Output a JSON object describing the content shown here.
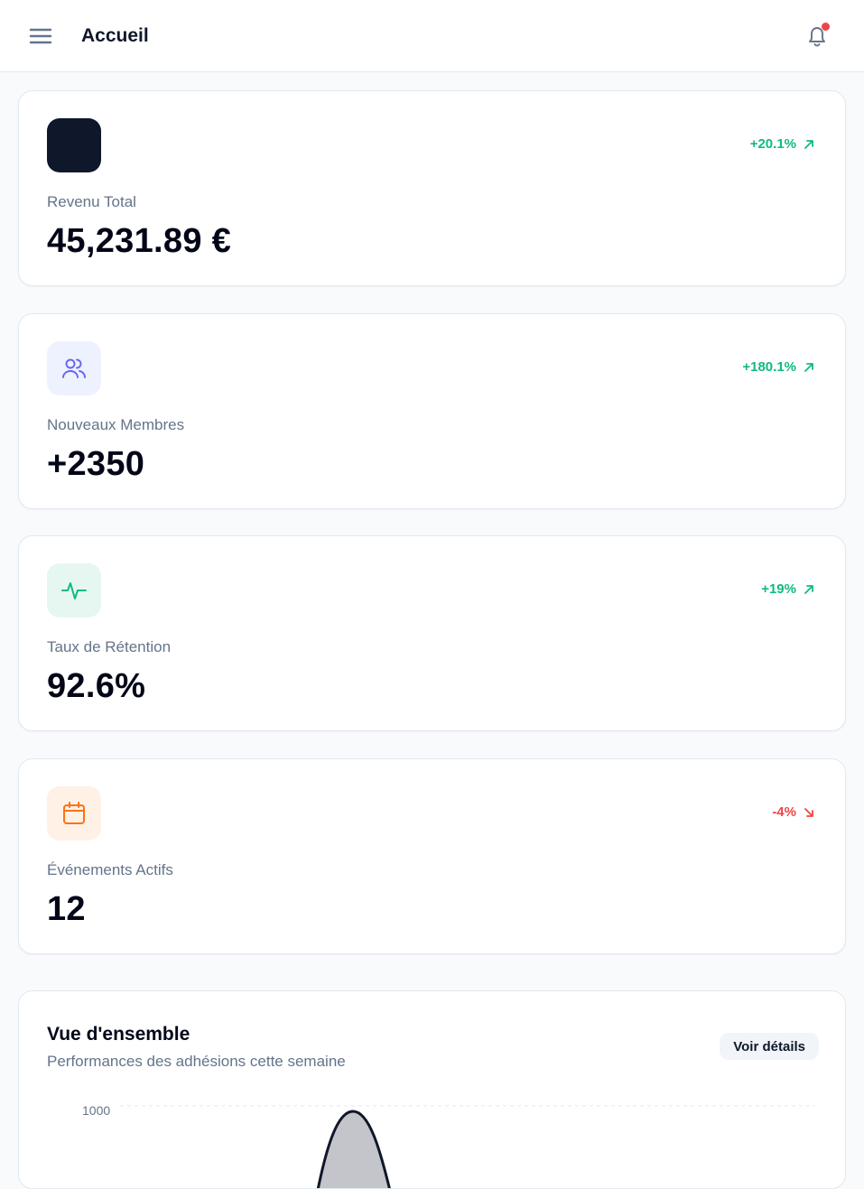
{
  "header": {
    "title": "Accueil",
    "menu_icon": "menu-icon",
    "notification_icon": "bell-icon",
    "notification_dot_color": "#ef4444"
  },
  "stats": [
    {
      "label": "Revenu Total",
      "value": "45,231.89 €",
      "trend": "+20.1%",
      "direction": "up",
      "icon": "dark-square-icon",
      "icon_bg": "#0f172a"
    },
    {
      "label": "Nouveaux Membres",
      "value": "+2350",
      "trend": "+180.1%",
      "direction": "up",
      "icon": "users-icon",
      "icon_bg": "#eef2ff",
      "icon_color": "#6366f1"
    },
    {
      "label": "Taux de Rétention",
      "value": "92.6%",
      "trend": "+19%",
      "direction": "up",
      "icon": "activity-icon",
      "icon_bg": "#e6f7f1",
      "icon_color": "#10b981"
    },
    {
      "label": "Événements Actifs",
      "value": "12",
      "trend": "-4%",
      "direction": "down",
      "icon": "calendar-icon",
      "icon_bg": "#fff1e6",
      "icon_color": "#f97316"
    }
  ],
  "colors": {
    "trend_up": "#10b981",
    "trend_down": "#ef4444"
  },
  "overview": {
    "title": "Vue d'ensemble",
    "subtitle": "Performances des adhésions cette semaine",
    "details_label": "Voir détails"
  },
  "chart_data": {
    "type": "area",
    "title": "",
    "xlabel": "",
    "ylabel": "",
    "y_ticks": [
      "1000"
    ],
    "grid": true,
    "series": [
      {
        "values": [
          1000
        ]
      }
    ]
  }
}
